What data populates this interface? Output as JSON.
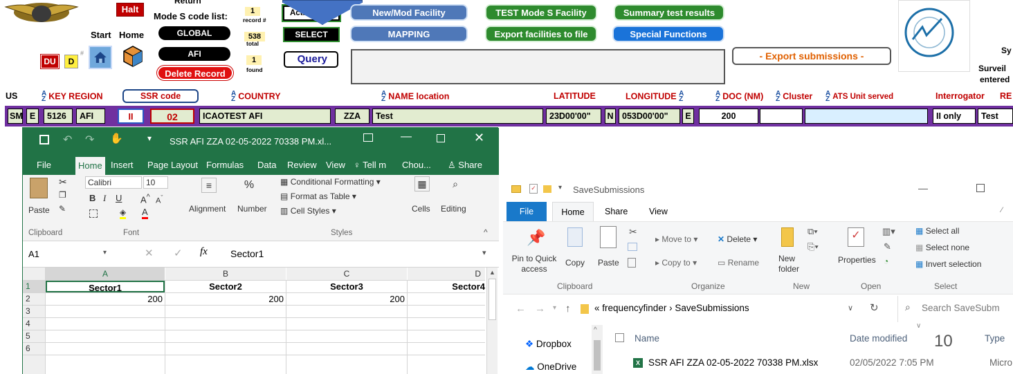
{
  "form": {
    "halt_label": "Halt",
    "return_label": "Return",
    "mode_s_label": "Mode S code list:",
    "start_label": "Start",
    "home_label": "Home",
    "du_label": "DU",
    "d_label": "D",
    "global_label": "GLOBAL",
    "afi_label": "AFI",
    "delete_record_label": "Delete Record",
    "record_num": "1",
    "record_caption": "record #",
    "total_num": "538",
    "total_caption": "total",
    "found_num": "1",
    "found_caption": "found",
    "active_find_label": "Active Find",
    "select_label": "SELECT",
    "query_label": "Query",
    "new_mod_label": "New/Mod Facility",
    "mapping_label": "MAPPING",
    "test_mode_s_label": "TEST Mode S Facility",
    "export_facilities_label": "Export facilities to file",
    "summary_label": "Summary test results",
    "special_functions_label": "Special Functions",
    "export_submissions_label": "- Export submissions -",
    "right_sy": "Sy",
    "right_surveil": "Surveil",
    "right_entered": "entered"
  },
  "headers": {
    "us": "US",
    "key_region": "KEY REGION",
    "ssr_code": "SSR code",
    "country": "COUNTRY",
    "name_location": "NAME location",
    "latitude": "LATITUDE",
    "longitude": "LONGITUDE",
    "doc": "DOC (NM)",
    "cluster": "Cluster",
    "ats_unit": "ATS Unit served",
    "interrogator": "Interrogator",
    "re": "RE"
  },
  "record": {
    "us": "SM",
    "e": "E",
    "key": "5126",
    "region": "AFI",
    "ssr1": "II",
    "ssr2": "02",
    "country": "ICAOTEST AFI",
    "code": "ZZA",
    "name": "Test",
    "latitude": "23D00'00\"",
    "lat_hemi": "N",
    "longitude": "053D00'00\"",
    "lon_hemi": "E",
    "doc": "200",
    "interrogator": "II only",
    "re": "Test"
  },
  "excel": {
    "title": "SSR AFI ZZA 02-05-2022 70338 PM.xl...",
    "tabs": [
      "File",
      "Home",
      "Insert",
      "Page Layout",
      "Formulas",
      "Data",
      "Review",
      "View"
    ],
    "tell_me": "Tell m",
    "user": "Chou...",
    "share": "Share",
    "font_name": "Calibri",
    "font_size": "10",
    "paste": "Paste",
    "alignment": "Alignment",
    "number": "Number",
    "conditional_formatting": "Conditional Formatting",
    "format_as_table": "Format as Table",
    "cell_styles": "Cell Styles",
    "cells": "Cells",
    "editing": "Editing",
    "group_clipboard": "Clipboard",
    "group_font": "Font",
    "group_styles": "Styles",
    "name_box": "A1",
    "fx": "fx",
    "formula_value": "Sector1",
    "columns": [
      "A",
      "B",
      "C",
      "D"
    ],
    "rows": [
      "1",
      "2",
      "3",
      "4",
      "5",
      "6"
    ],
    "header_row": [
      "Sector1",
      "Sector2",
      "Sector3",
      "Sector4"
    ],
    "data_row": [
      "200",
      "200",
      "200",
      ""
    ]
  },
  "explorer": {
    "title": "SaveSubmissions",
    "tabs": [
      "File",
      "Home",
      "Share",
      "View"
    ],
    "pin_label": "Pin to Quick access",
    "copy_label": "Copy",
    "paste_label": "Paste",
    "move_to": "Move to",
    "copy_to": "Copy to",
    "delete": "Delete",
    "rename": "Rename",
    "new_folder": "New folder",
    "properties": "Properties",
    "select_all": "Select all",
    "select_none": "Select none",
    "invert_selection": "Invert selection",
    "group_clipboard": "Clipboard",
    "group_organize": "Organize",
    "group_new": "New",
    "group_open": "Open",
    "group_select": "Select",
    "path_parent": "frequencyfinder",
    "path_current": "SaveSubmissions",
    "search_placeholder": "Search SaveSubm",
    "col_name": "Name",
    "col_date": "Date modified",
    "col_type": "Type",
    "nav_dropbox": "Dropbox",
    "nav_onedrive": "OneDrive",
    "file_name": "SSR AFI ZZA 02-05-2022 70338 PM.xlsx",
    "file_date": "02/05/2022 7:05 PM",
    "file_type": "Micro",
    "overlay_number": "10"
  },
  "colors": {
    "excel_green": "#217346",
    "record_border": "#7030a0",
    "access_green": "#2e8b2e",
    "access_blue": "#4f78b8",
    "delete_red": "#e01010"
  }
}
